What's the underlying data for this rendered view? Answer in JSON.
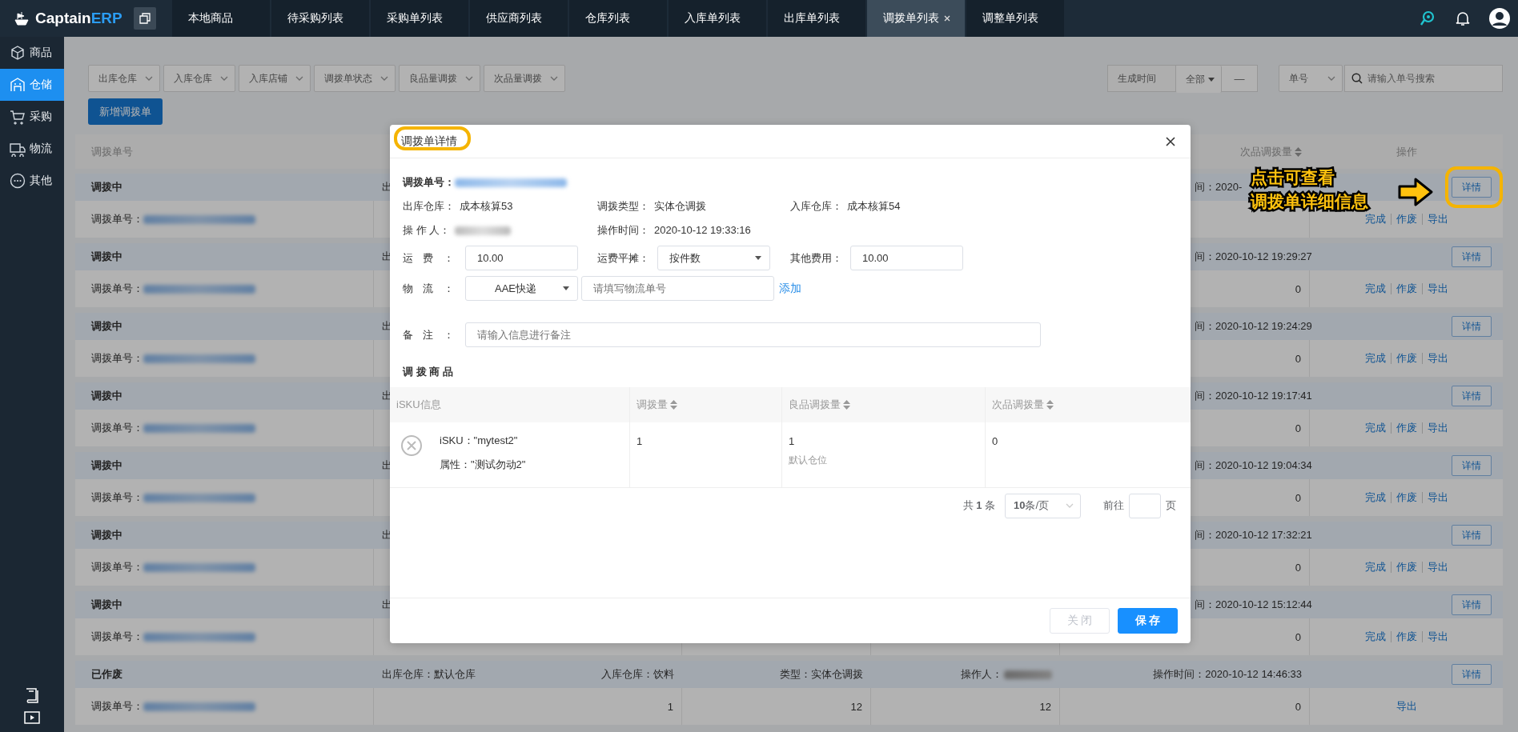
{
  "logo": {
    "name_main": "Captain",
    "name_accent": "ERP"
  },
  "top_tabs": [
    {
      "label": "本地商品",
      "selected": false,
      "closable": false
    },
    {
      "label": "待采购列表",
      "selected": false,
      "closable": false
    },
    {
      "label": "采购单列表",
      "selected": false,
      "closable": false
    },
    {
      "label": "供应商列表",
      "selected": false,
      "closable": false
    },
    {
      "label": "仓库列表",
      "selected": false,
      "closable": false
    },
    {
      "label": "入库单列表",
      "selected": false,
      "closable": false
    },
    {
      "label": "出库单列表",
      "selected": false,
      "closable": false
    },
    {
      "label": "调拨单列表",
      "selected": true,
      "closable": true
    },
    {
      "label": "调整单列表",
      "selected": false,
      "closable": false
    }
  ],
  "sidebar": {
    "items": [
      {
        "label": "商品",
        "selected": false
      },
      {
        "label": "仓储",
        "selected": true
      },
      {
        "label": "采购",
        "selected": false
      },
      {
        "label": "物流",
        "selected": false
      },
      {
        "label": "其他",
        "selected": false
      }
    ]
  },
  "filters": {
    "dropdowns": [
      "出库仓库",
      "入库仓库",
      "入库店铺",
      "调拨单状态",
      "良品量调拨",
      "次品量调拨"
    ],
    "date": {
      "label": "生成时间",
      "range": "全部",
      "separator": "—"
    },
    "search": {
      "type": "单号",
      "placeholder": "请输入单号搜索"
    }
  },
  "new_button": "新增调拨单",
  "table": {
    "header": {
      "order_no": "调拨单号",
      "bad_qty": "次品调拨量",
      "actions": "操作"
    },
    "groups": [
      {
        "kind": "covered",
        "status": "调拨中",
        "out_warehouse": "出",
        "time": "间：2020-",
        "order_label": "调拨单号：",
        "actions": [
          "完成",
          "作废",
          "导出"
        ],
        "detail_button": "详情"
      },
      {
        "kind": "covered",
        "status": "调拨中",
        "out_warehouse": "出",
        "time": "间：2020-10-12 19:29:27",
        "order_label": "调拨单号：",
        "bad_qty": "0",
        "actions": [
          "完成",
          "作废",
          "导出"
        ],
        "detail_button": "详情"
      },
      {
        "kind": "covered",
        "status": "调拨中",
        "out_warehouse": "出",
        "time": "间：2020-10-12 19:24:29",
        "order_label": "调拨单号：",
        "bad_qty": "0",
        "actions": [
          "完成",
          "作废",
          "导出"
        ],
        "detail_button": "详情"
      },
      {
        "kind": "covered",
        "status": "调拨中",
        "out_warehouse": "出",
        "time": "间：2020-10-12 19:17:41",
        "order_label": "调拨单号：",
        "bad_qty": "0",
        "actions": [
          "完成",
          "作废",
          "导出"
        ],
        "detail_button": "详情"
      },
      {
        "kind": "covered",
        "status": "调拨中",
        "out_warehouse": "出",
        "time": "间：2020-10-12 19:04:34",
        "order_label": "调拨单号：",
        "bad_qty": "0",
        "actions": [
          "完成",
          "作废",
          "导出"
        ],
        "detail_button": "详情"
      },
      {
        "kind": "covered",
        "status": "调拨中",
        "out_warehouse": "出",
        "time": "间：2020-10-12 17:32:21",
        "order_label": "调拨单号：",
        "bad_qty": "0",
        "actions": [
          "完成",
          "作废",
          "导出"
        ],
        "detail_button": "详情"
      },
      {
        "kind": "covered",
        "status": "调拨中",
        "out_warehouse": "出",
        "time": "间：2020-10-12 15:12:44",
        "order_label": "调拨单号：",
        "bad_qty": "0",
        "actions": [
          "完成",
          "作废",
          "导出"
        ],
        "detail_button": "详情"
      },
      {
        "kind": "full",
        "status": "已作废",
        "out_warehouse": "出库仓库：默认仓库",
        "in_warehouse": "入库仓库：饮料",
        "type": "类型：实体仓调拨",
        "operator_label": "操作人：",
        "time": "操作时间：2020-10-12 14:46:33",
        "order_label": "调拨单号：",
        "cell_2": "1",
        "cell_3": "12",
        "cell_4": "12",
        "bad_qty": "0",
        "actions": [
          "导出"
        ],
        "detail_button": "详情"
      }
    ]
  },
  "modal": {
    "title": "调拨单详情",
    "order_label": "调拨单号：",
    "info_rows": [
      [
        {
          "label": "出库仓库：",
          "value": "成本核算53"
        },
        {
          "label": "调拨类型：",
          "value": "实体仓调拨"
        },
        {
          "label": "入库仓库：",
          "value": "成本核算54"
        }
      ],
      [
        {
          "label": "操 作 人：",
          "blurred": true
        },
        {
          "label": "操作时间：",
          "value": "2020-10-12 19:33:16"
        }
      ]
    ],
    "freight": {
      "label": "运 费 ：",
      "value": "10.00"
    },
    "freight_split": {
      "label": "运费平摊：",
      "value": "按件数"
    },
    "other_fee": {
      "label": "其他费用：",
      "value": "10.00"
    },
    "logistics": {
      "label": "物 流 ：",
      "carrier": "AAE快递",
      "placeholder": "请填写物流单号",
      "add_link": "添加"
    },
    "remarks": {
      "label": "备 注 ：",
      "placeholder": "请输入信息进行备注"
    },
    "section_title": "调 拨 商 品",
    "columns": [
      {
        "label": "iSKU信息",
        "sortable": false
      },
      {
        "label": "调拨量",
        "sortable": true
      },
      {
        "label": "良品调拨量",
        "sortable": true
      },
      {
        "label": "次品调拨量",
        "sortable": true
      }
    ],
    "rows": [
      {
        "sku": "iSKU：\"mytest2\"",
        "attr": "属性：\"测试勿动2\"",
        "qty": "1",
        "good_qty": "1",
        "good_location": "默认仓位",
        "bad_qty": "0"
      }
    ],
    "pagination": {
      "total": "共 **1** 条",
      "page_size": "**10**条/页",
      "goto_label": "前往",
      "page_label": "页"
    },
    "buttons": [
      {
        "label": "关 闭",
        "disabled": true
      },
      {
        "label": "保 存",
        "disabled": false
      }
    ]
  },
  "callout": {
    "lines": [
      "点击可查看",
      "调拨单详细信息"
    ]
  }
}
